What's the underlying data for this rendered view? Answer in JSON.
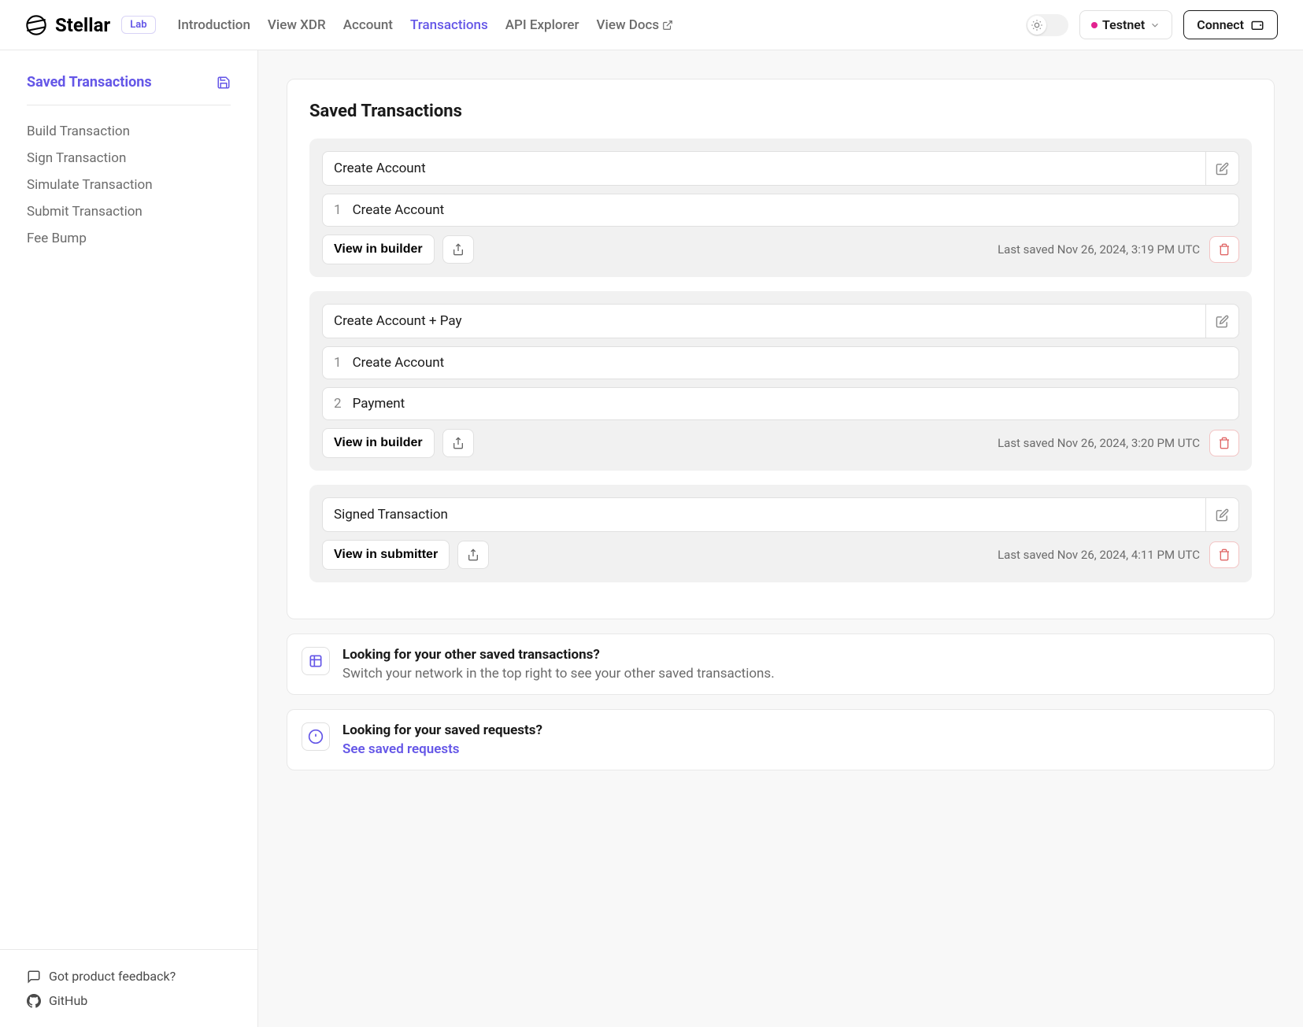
{
  "header": {
    "logo_text": "Stellar",
    "lab_badge": "Lab",
    "nav": [
      {
        "label": "Introduction"
      },
      {
        "label": "View XDR"
      },
      {
        "label": "Account"
      },
      {
        "label": "Transactions",
        "active": true
      },
      {
        "label": "API Explorer"
      },
      {
        "label": "View Docs",
        "external": true
      }
    ],
    "network_label": "Testnet",
    "connect_label": "Connect"
  },
  "sidebar": {
    "title": "Saved Transactions",
    "items": [
      {
        "label": "Build Transaction"
      },
      {
        "label": "Sign Transaction"
      },
      {
        "label": "Simulate Transaction"
      },
      {
        "label": "Submit Transaction"
      },
      {
        "label": "Fee Bump"
      }
    ],
    "footer": [
      {
        "label": "Got product feedback?",
        "icon": "chat"
      },
      {
        "label": "GitHub",
        "icon": "github"
      }
    ]
  },
  "main": {
    "title": "Saved Transactions",
    "transactions": [
      {
        "name": "Create Account",
        "operations": [
          {
            "num": "1",
            "name": "Create Account"
          }
        ],
        "action_label": "View in builder",
        "last_saved": "Last saved Nov 26, 2024, 3:19 PM UTC"
      },
      {
        "name": "Create Account + Pay",
        "operations": [
          {
            "num": "1",
            "name": "Create Account"
          },
          {
            "num": "2",
            "name": "Payment"
          }
        ],
        "action_label": "View in builder",
        "last_saved": "Last saved Nov 26, 2024, 3:20 PM UTC"
      },
      {
        "name": "Signed Transaction",
        "operations": [],
        "action_label": "View in submitter",
        "last_saved": "Last saved Nov 26, 2024, 4:11 PM UTC"
      }
    ],
    "info1": {
      "title": "Looking for your other saved transactions?",
      "text": "Switch your network in the top right to see your other saved transactions."
    },
    "info2": {
      "title": "Looking for your saved requests?",
      "link": "See saved requests"
    }
  }
}
